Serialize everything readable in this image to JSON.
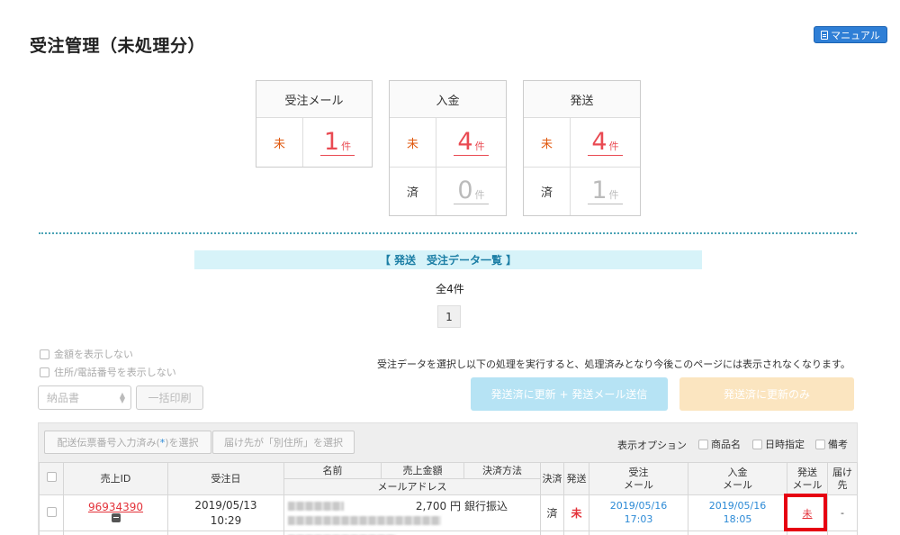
{
  "page": {
    "title": "受注管理（未処理分）",
    "manual_label": "マニュアル"
  },
  "stats": [
    {
      "header": "受注メール",
      "rows": [
        {
          "label": "未",
          "value": "1",
          "unit": "件",
          "tone": "red"
        }
      ]
    },
    {
      "header": "入金",
      "rows": [
        {
          "label": "未",
          "value": "4",
          "unit": "件",
          "tone": "red"
        },
        {
          "label": "済",
          "value": "0",
          "unit": "件",
          "tone": "gray"
        }
      ]
    },
    {
      "header": "発送",
      "rows": [
        {
          "label": "未",
          "value": "4",
          "unit": "件",
          "tone": "red"
        },
        {
          "label": "済",
          "value": "1",
          "unit": "件",
          "tone": "gray"
        }
      ]
    }
  ],
  "list": {
    "banner": "【 発送　受注データ一覧 】",
    "count": "全4件",
    "page": "1"
  },
  "options": {
    "hide_amount": "金額を表示しない",
    "hide_address": "住所/電話番号を表示しない",
    "select_value": "納品書",
    "bulk_print": "一括印刷",
    "info_text": "受注データを選択し以下の処理を実行すると、処理済みとなり今後このページには表示されなくなります。",
    "btn_update_mail": "発送済に更新 + 発送メール送信",
    "btn_update_only": "発送済に更新のみ"
  },
  "filters": {
    "select_tracking_prefix": "配送伝票番号入力済み(",
    "select_tracking_mark": "*",
    "select_tracking_suffix": ")を選択",
    "select_other_address": "届け先が「別住所」を選択",
    "display_option": "表示オプション",
    "opt_product": "商品名",
    "opt_datetime": "日時指定",
    "opt_note": "備考"
  },
  "table": {
    "headers": {
      "sale_id": "売上ID",
      "order_date": "受注日",
      "name": "名前",
      "amount": "売上金額",
      "payment": "決済方法",
      "email": "メールアドレス",
      "settled": "決済",
      "shipped": "発送",
      "order_mail_1": "受注",
      "order_mail_2": "メール",
      "payment_mail_1": "入金",
      "payment_mail_2": "メール",
      "ship_mail_1": "発送",
      "ship_mail_2": "メール",
      "dest": "届け先"
    },
    "rows": [
      {
        "sale_id": "96934390",
        "date": "2019/05/13",
        "time": "10:29",
        "amount": "2,700 円",
        "payment": "銀行振込",
        "settled": "済",
        "shipped": "未",
        "order_mail_date": "2019/05/16",
        "order_mail_time": "17:03",
        "payment_mail_date": "2019/05/16",
        "payment_mail_time": "18:05",
        "ship_mail": "未",
        "dest": "-"
      }
    ]
  },
  "colors": {
    "accent_red": "#e94a52",
    "link_blue": "#2c8ad6",
    "highlight": "#e60012"
  }
}
